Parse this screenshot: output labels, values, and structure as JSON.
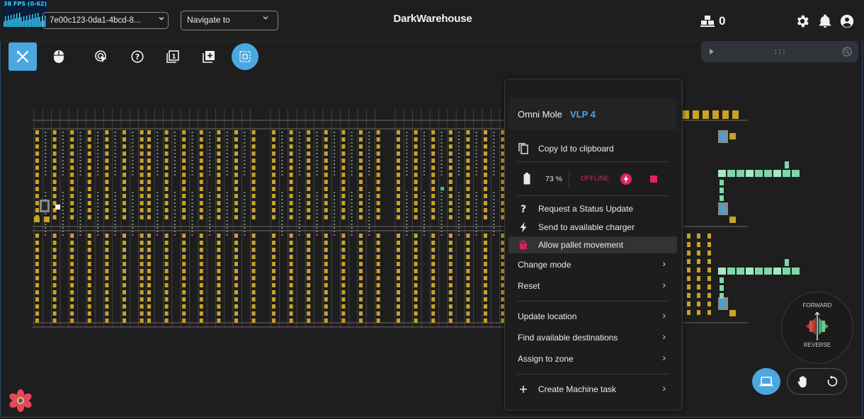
{
  "header": {
    "fps_label": "38 FPS (0-62)",
    "session_select": "7e00c123-0da1-4bcd-8...",
    "navigate_placeholder": "Navigate to",
    "app_title": "DarkWarehouse",
    "pallet_count": "0"
  },
  "toolbar": {
    "tools": [
      "tools-icon",
      "mouse-icon",
      "target-cursor-icon",
      "help-icon",
      "layer-1-icon",
      "add-layer-icon",
      "select-area-icon"
    ],
    "active_tool": "tools-icon"
  },
  "context_menu": {
    "machine_name": "Omni Mole",
    "machine_id": "VLP 4",
    "copy_id": "Copy Id to clipboard",
    "battery_percent": "73 %",
    "status": "OFFLINE",
    "request_status": "Request a Status Update",
    "send_to_charger": "Send to available charger",
    "allow_pallet": "Allow pallet movement",
    "change_mode": "Change mode",
    "reset": "Reset",
    "update_location": "Update location",
    "find_destinations": "Find available destinations",
    "assign_zone": "Assign to zone",
    "create_task": "Create Machine task"
  },
  "direction_control": {
    "forward": "FORWARD",
    "reverse": "REVERSE"
  },
  "colors": {
    "accent": "#4ba7e0",
    "rack_yellow": "#c9a227",
    "offline_red": "#e0245e",
    "station_green": "#7fd6a8"
  }
}
